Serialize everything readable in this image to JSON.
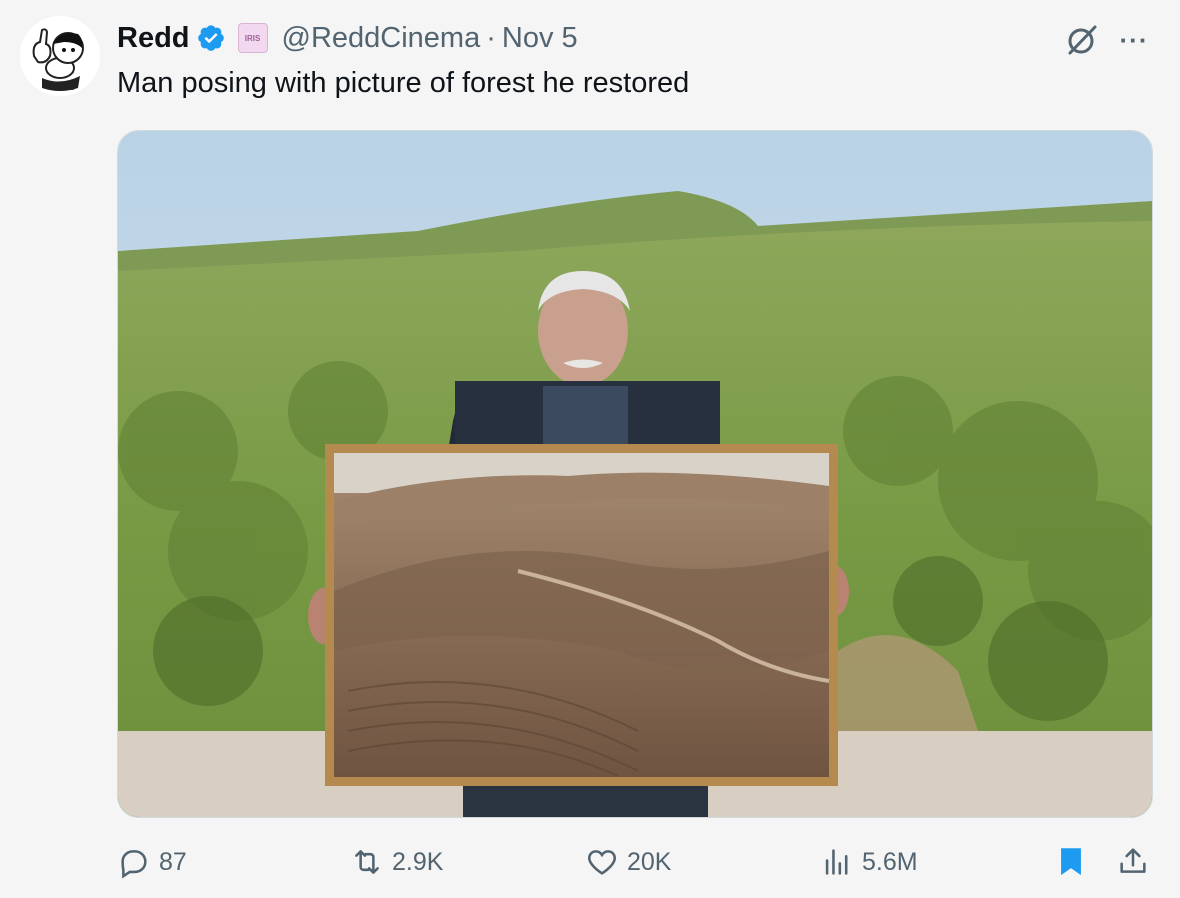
{
  "author": {
    "name": "Redd",
    "handle": "@ReddCinema",
    "separator": "·",
    "date": "Nov 5",
    "affiliate_badge": "IRIS"
  },
  "tweet": {
    "text": "Man posing with picture of forest he restored"
  },
  "icons": {
    "verified": "verified-badge-icon",
    "grok": "grok-icon",
    "more": "more-icon",
    "reply": "reply-icon",
    "retweet": "retweet-icon",
    "like": "heart-icon",
    "views": "views-icon",
    "bookmark": "bookmark-icon",
    "share": "share-icon"
  },
  "actions": {
    "replies": "87",
    "retweets": "2.9K",
    "likes": "20K",
    "views": "5.6M"
  },
  "colors": {
    "verified": "#1d9bf0",
    "bookmark": "#1d9bf0",
    "secondary_text": "#536471"
  }
}
